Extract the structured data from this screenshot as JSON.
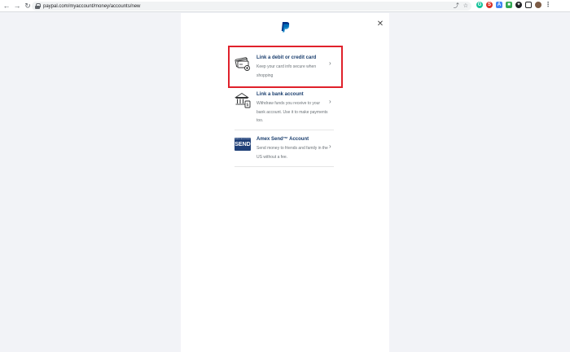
{
  "browser": {
    "back_icon": "arrow-left-icon",
    "forward_icon": "arrow-right-icon",
    "reload_icon": "reload-icon",
    "url": "paypal.com/myaccount/money/accounts/new",
    "extensions": [
      {
        "name": "share-icon",
        "color": "#5f6368"
      },
      {
        "name": "star-icon",
        "color": "#5f6368"
      },
      {
        "name": "grammarly-icon",
        "color": "#15c39a"
      },
      {
        "name": "s-extension-icon",
        "color": "#d93025"
      },
      {
        "name": "translate-icon",
        "color": "#4285f4"
      },
      {
        "name": "badge-extension-icon",
        "color": "#34a853"
      },
      {
        "name": "puzzle-icon",
        "color": "#202124"
      },
      {
        "name": "reading-list-icon",
        "color": "#202124"
      },
      {
        "name": "profile-avatar-icon",
        "color": "#7b5b45"
      },
      {
        "name": "kebab-menu-icon",
        "color": "#5f6368"
      }
    ]
  },
  "modal": {
    "logo_icon": "paypal-logo-icon",
    "close_icon": "close-icon",
    "options": [
      {
        "title": "Link a debit or credit card",
        "description": "Keep your card info secure when shopping",
        "icon": "credit-card-icon"
      },
      {
        "title": "Link a bank account",
        "description": "Withdraw funds you receive to your bank account. Use it to make payments too.",
        "icon": "bank-icon"
      },
      {
        "title": "Amex Send™ Account",
        "description": "Send money to friends and family in the US without a fee.",
        "icon": "amex-send-icon",
        "icon_text_top": "AMERICAN EXPRESS",
        "icon_text": "SEND"
      }
    ]
  },
  "colors": {
    "page_bg": "#f2f3f7",
    "title_blue": "#1a3e6e",
    "highlight_red": "#e0212b",
    "amex_blue": "#1f3f77"
  }
}
